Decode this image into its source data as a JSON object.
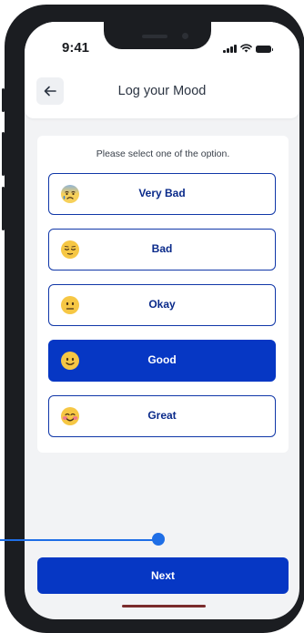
{
  "status_bar": {
    "time": "9:41"
  },
  "header": {
    "title": "Log your Mood"
  },
  "prompt": "Please select one of the option.",
  "options": [
    {
      "label": "Very Bad",
      "icon": "anxious-face-icon",
      "selected": false
    },
    {
      "label": "Bad",
      "icon": "relieved-face-icon",
      "selected": false
    },
    {
      "label": "Okay",
      "icon": "neutral-face-icon",
      "selected": false
    },
    {
      "label": "Good",
      "icon": "slightly-smiling-face-icon",
      "selected": true
    },
    {
      "label": "Great",
      "icon": "blushing-face-icon",
      "selected": false
    }
  ],
  "next_button": {
    "label": "Next"
  },
  "colors": {
    "accent": "#0637c4",
    "border": "#1037a8",
    "slider": "#1f6ee6",
    "background": "#f2f3f5"
  }
}
